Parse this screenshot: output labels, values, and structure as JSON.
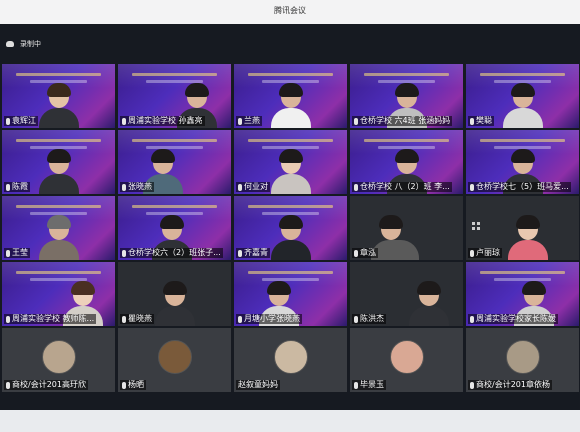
{
  "window": {
    "title": "腾讯会议"
  },
  "recording": {
    "label": "录制中"
  },
  "participants": [
    {
      "name": "袁辉江"
    },
    {
      "name": "周浦实验学校 孙鑫亮"
    },
    {
      "name": "兰燕"
    },
    {
      "name": "仓桥学校 六4班 张涵妈妈"
    },
    {
      "name": "樊聪"
    },
    {
      "name": "陈霞"
    },
    {
      "name": "张晓燕"
    },
    {
      "name": "何业对"
    },
    {
      "name": "仓桥学校 八（2）班 李..."
    },
    {
      "name": "仓桥学校七（5）班马爱..."
    },
    {
      "name": "王莹"
    },
    {
      "name": "仓桥学校六（2）班张子..."
    },
    {
      "name": "齐嘉青"
    },
    {
      "name": "章泓"
    },
    {
      "name": "卢丽琼"
    },
    {
      "name": "周浦实验学校 教师陈..."
    },
    {
      "name": "瞿晓燕"
    },
    {
      "name": "月塘小学张晓燕"
    },
    {
      "name": "陈洪杰"
    },
    {
      "name": "周浦实验学校家长陈媛"
    },
    {
      "name": "商校/会计201高玗欣"
    },
    {
      "name": "杨晒"
    },
    {
      "name": "赵叙童妈妈"
    },
    {
      "name": "毕景玉"
    },
    {
      "name": "商校/会计201章依杨"
    }
  ]
}
